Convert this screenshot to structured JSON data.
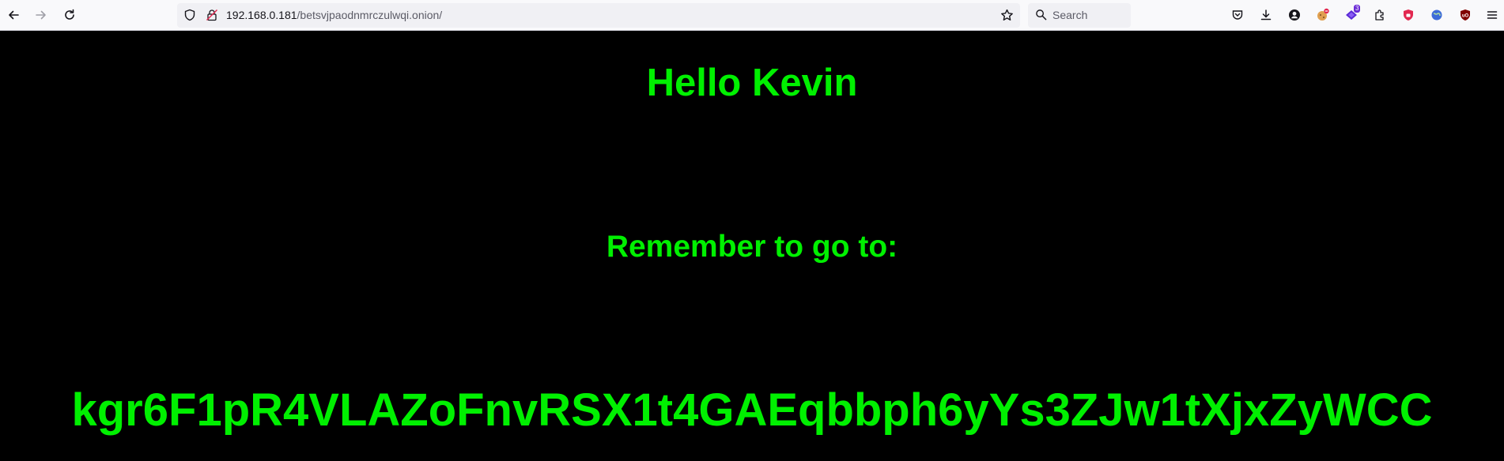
{
  "browser": {
    "url_host": "192.168.0.181",
    "url_path": "/betsvjpaodnmrczulwqi.onion/",
    "search_placeholder": "Search",
    "extension_badge_count": "3",
    "icons": {
      "back": "back-arrow-icon",
      "forward": "forward-arrow-icon",
      "reload": "reload-icon",
      "shield": "tracking-protection-shield-icon",
      "insecure_lock": "insecure-connection-lock-icon",
      "bookmark": "bookmark-star-icon",
      "search": "search-icon",
      "pocket": "pocket-icon",
      "downloads": "download-icon",
      "account": "account-icon",
      "extensions": "extensions-puzzle-icon",
      "menu": "hamburger-menu-icon"
    }
  },
  "page": {
    "greeting": "Hello Kevin",
    "reminder": "Remember to go to:",
    "code": "kgr6F1pR4VLAZoFnvRSX1t4GAEqbbph6yYs3ZJw1tXjxZyWCC",
    "text_color": "#00f000",
    "background_color": "#000000"
  }
}
